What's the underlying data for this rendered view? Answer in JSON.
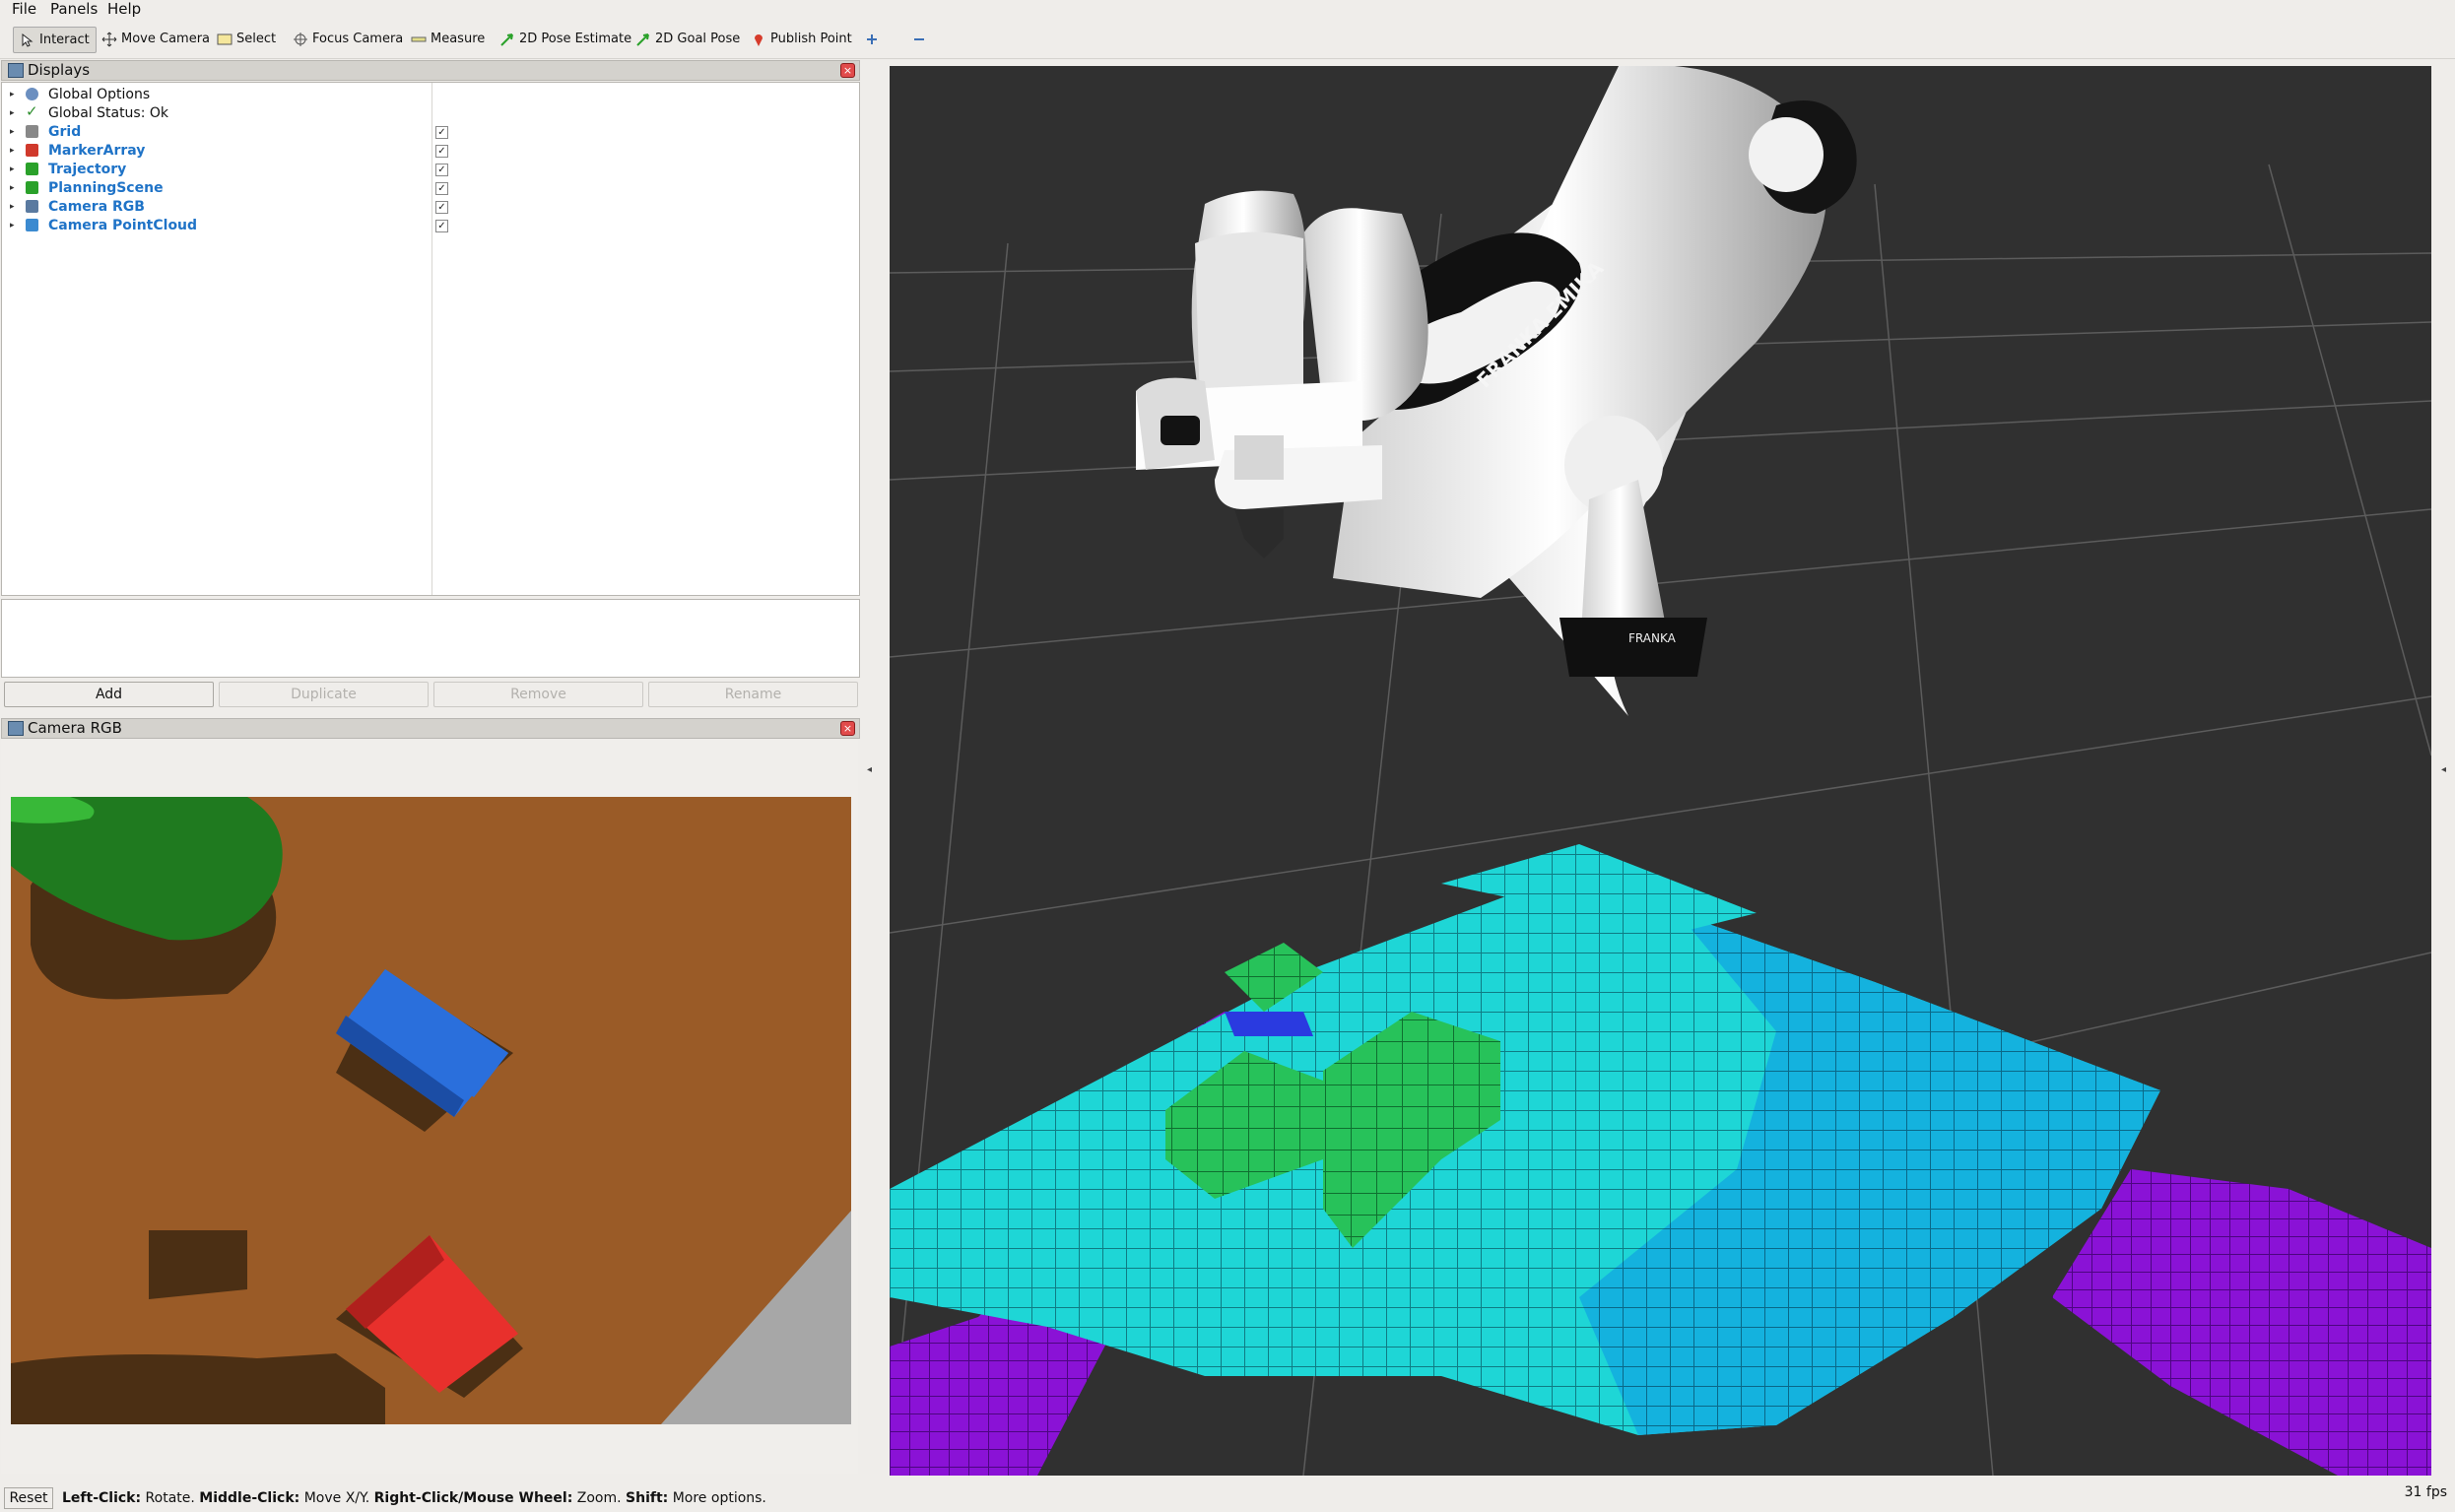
{
  "menu": [
    "File",
    "Panels",
    "Help"
  ],
  "toolbar": {
    "items": [
      {
        "label": "Interact",
        "icon": "interact-cursor-icon"
      },
      {
        "label": "Move Camera",
        "icon": "move-camera-icon"
      },
      {
        "label": "Select",
        "icon": "select-icon"
      },
      {
        "label": "Focus Camera",
        "icon": "focus-camera-icon"
      },
      {
        "label": "Measure",
        "icon": "measure-icon"
      },
      {
        "label": "2D Pose Estimate",
        "icon": "pose-estimate-arrow-icon"
      },
      {
        "label": "2D Goal Pose",
        "icon": "goal-pose-arrow-icon"
      },
      {
        "label": "Publish Point",
        "icon": "publish-point-pin-icon"
      }
    ],
    "add_icon": "plus-icon",
    "remove_icon": "minus-icon"
  },
  "displays_panel": {
    "title": "Displays",
    "items": [
      {
        "label": "Global Options",
        "icon": "gear-icon",
        "checkbox": false
      },
      {
        "label": "Global Status: Ok",
        "icon": "checkmark-icon",
        "checkbox": false
      },
      {
        "label": "Grid",
        "icon": "grid-icon",
        "checkbox": true,
        "checked": true
      },
      {
        "label": "MarkerArray",
        "icon": "marker-array-icon",
        "checkbox": true,
        "checked": true
      },
      {
        "label": "Trajectory",
        "icon": "trajectory-icon",
        "checkbox": true,
        "checked": true
      },
      {
        "label": "PlanningScene",
        "icon": "planning-scene-icon",
        "checkbox": true,
        "checked": true
      },
      {
        "label": "Camera RGB",
        "icon": "camera-image-icon",
        "checkbox": true,
        "checked": true
      },
      {
        "label": "Camera PointCloud",
        "icon": "pointcloud-icon",
        "checkbox": true,
        "checked": true
      }
    ],
    "buttons": {
      "add": "Add",
      "duplicate": "Duplicate",
      "remove": "Remove",
      "rename": "Rename"
    }
  },
  "camera_panel": {
    "title": "Camera RGB"
  },
  "robot_brand": "FRANKA EMIKA",
  "robot_brand_base": "FRANKA",
  "status": {
    "reset": "Reset",
    "left_click_key": "Left-Click:",
    "left_click_action": " Rotate. ",
    "middle_click_key": "Middle-Click:",
    "middle_click_action": " Move X/Y. ",
    "right_click_key": "Right-Click/Mouse Wheel:",
    "right_click_action": " Zoom. ",
    "shift_key": "Shift:",
    "shift_action": " More options.",
    "fps": "31 fps"
  },
  "colors": {
    "voxel_cyan": "#1ed6d6",
    "voxel_green": "#27c25a",
    "voxel_purple": "#8a12d6",
    "viewport_bg": "#303030",
    "camera_floor": "#9a5b27"
  }
}
